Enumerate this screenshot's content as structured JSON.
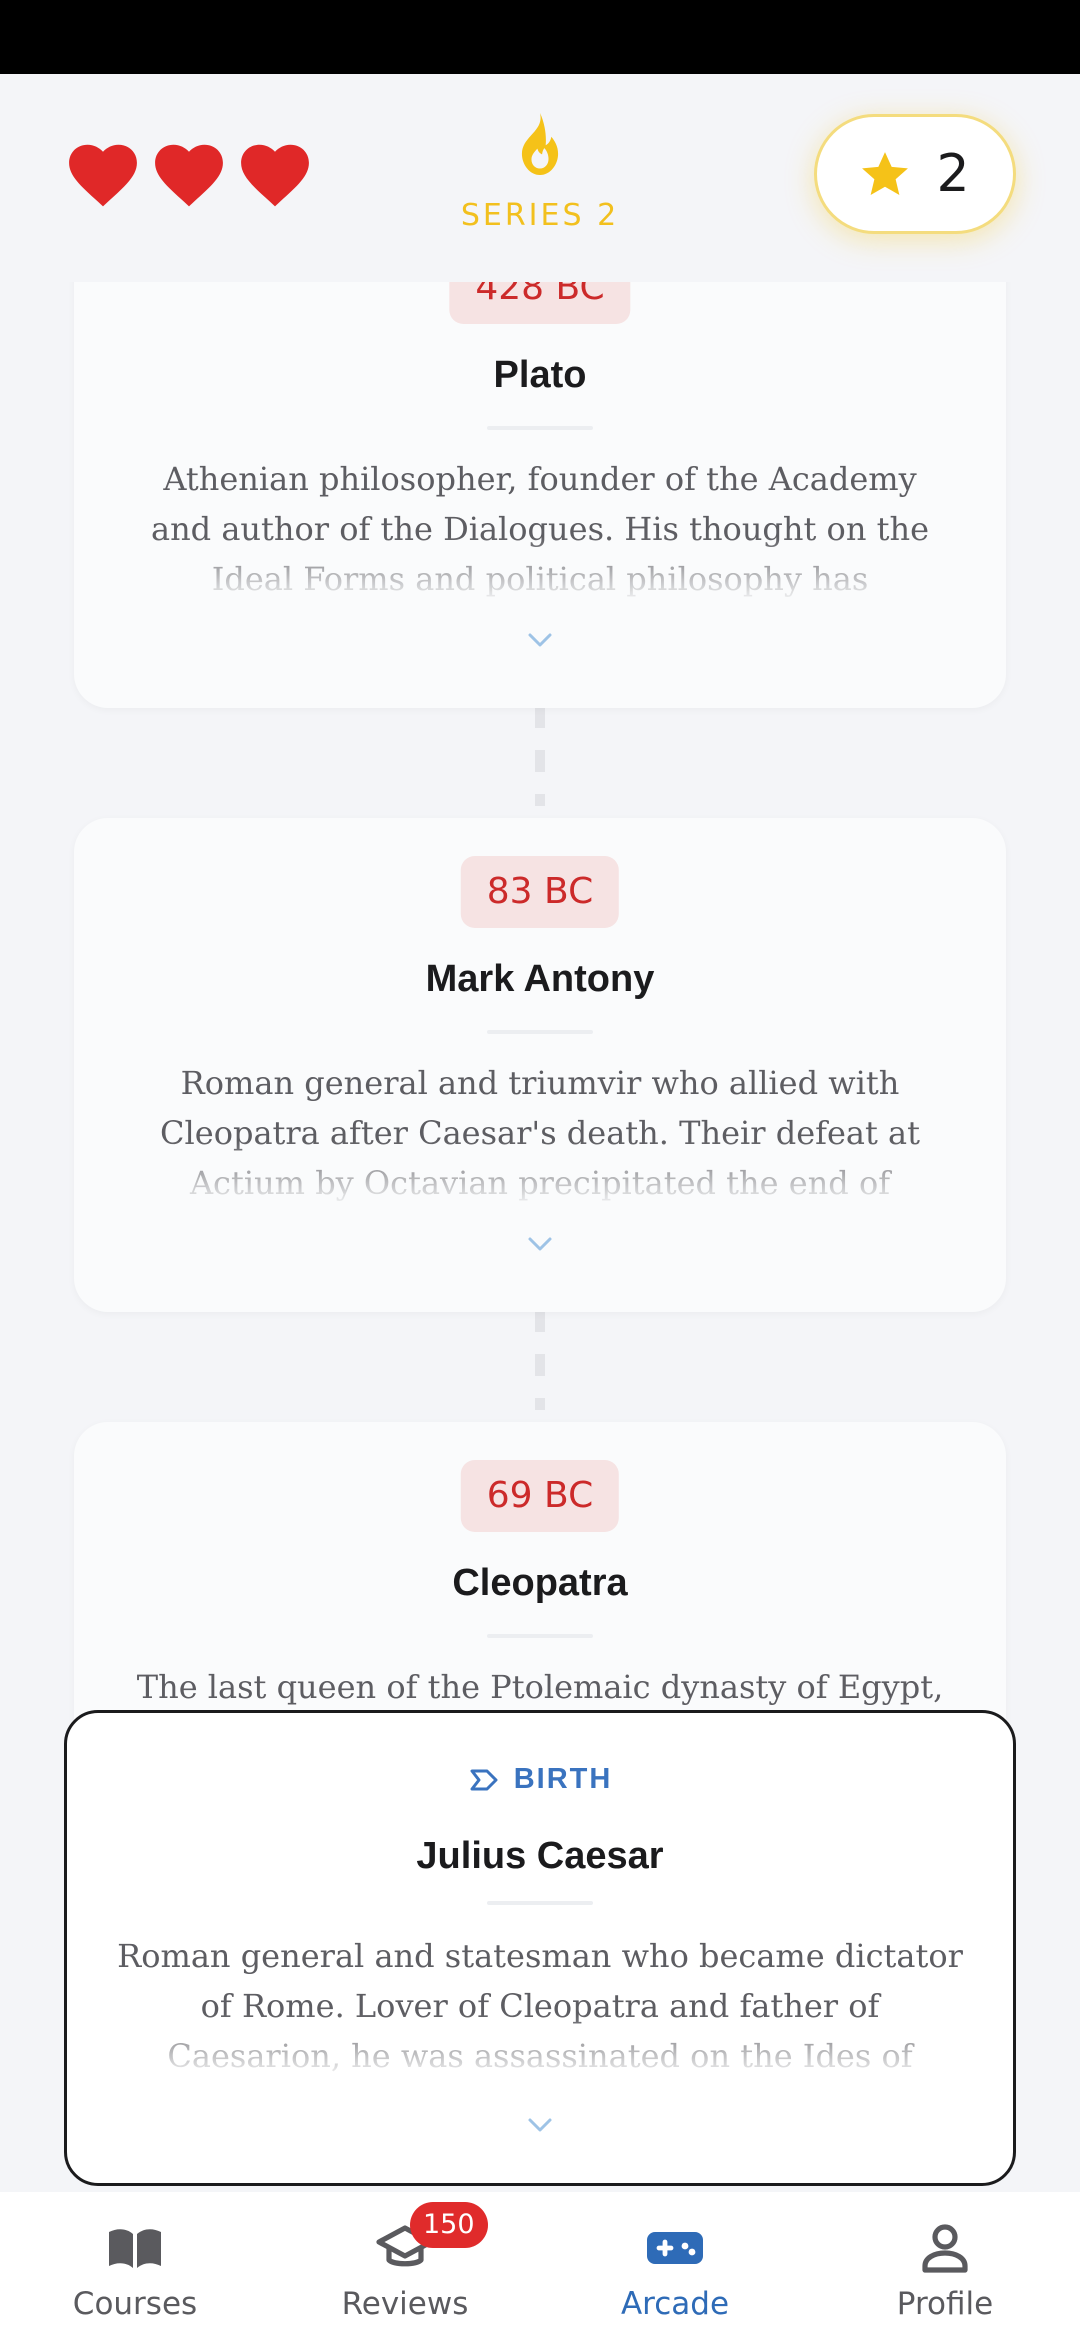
{
  "header": {
    "lives": 3,
    "series_label": "SERIES 2",
    "stars": "2",
    "colors": {
      "heart": "#e02828",
      "flame": "#f5c218",
      "star": "#f5c218"
    }
  },
  "timeline": {
    "cards": [
      {
        "year": "428 BC",
        "name": "Plato",
        "description": "Athenian philosopher, founder of the Academy and author of the Dialogues. His thought on the Ideal Forms and political philosophy has"
      },
      {
        "year": "83 BC",
        "name": "Mark Antony",
        "description": "Roman general and triumvir who allied with Cleopatra after Caesar's death. Their defeat at Actium by Octavian precipitated the end of"
      },
      {
        "year": "69 BC",
        "name": "Cleopatra",
        "description": "The last queen of the Ptolemaic dynasty of Egypt,"
      }
    ]
  },
  "active_card": {
    "event_type": "BIRTH",
    "name": "Julius Caesar",
    "description": "Roman general and statesman who became dictator of Rome. Lover of Cleopatra and father of Caesarion, he was assassinated on the Ides of"
  },
  "nav": {
    "items": [
      {
        "label": "Courses",
        "icon": "book-icon"
      },
      {
        "label": "Reviews",
        "icon": "graduation-cap-icon",
        "badge": "150"
      },
      {
        "label": "Arcade",
        "icon": "gamepad-icon",
        "active": true
      },
      {
        "label": "Profile",
        "icon": "person-icon"
      }
    ],
    "active_color": "#2e6bb7"
  }
}
